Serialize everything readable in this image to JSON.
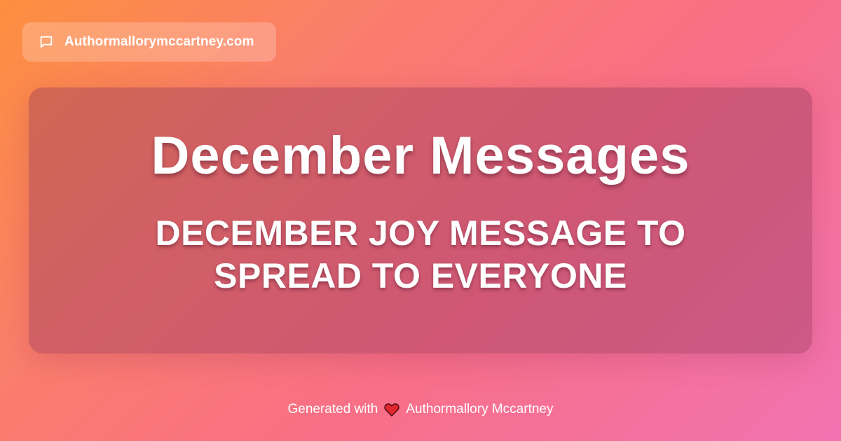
{
  "site": {
    "name": "Authormallorymccartney.com",
    "icon": "chat-bubble-icon"
  },
  "card": {
    "title": "December Messages",
    "subtitle": "DECEMBER JOY MESSAGE TO SPREAD TO EVERYONE"
  },
  "footer": {
    "prefix": "Generated with",
    "icon": "heart-icon",
    "author": "Authormallory Mccartney"
  },
  "colors": {
    "gradient_start": "#fd8f3f",
    "gradient_mid": "#f86f87",
    "gradient_end": "#f173b1",
    "heart": "#e0262f"
  }
}
